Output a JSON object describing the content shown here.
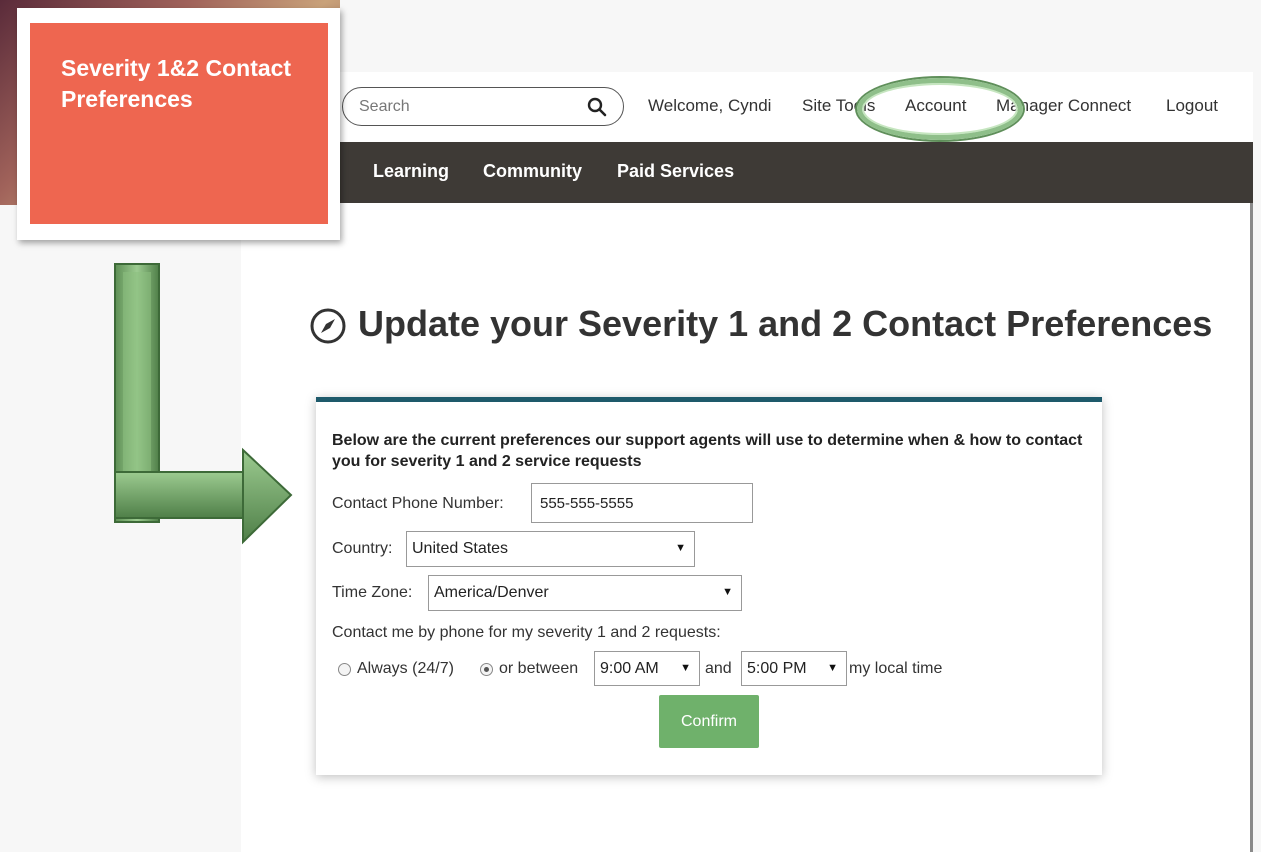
{
  "callout": {
    "title": "Severity 1&2 Contact Preferences",
    "color": "#ee6650"
  },
  "header": {
    "search_placeholder": "Search",
    "welcome": "Welcome, Cyndi",
    "links": [
      "Site Tools",
      "Account",
      "Manager Connect",
      "Logout"
    ]
  },
  "nav": {
    "items": [
      "Learning",
      "Community",
      "Paid Services"
    ]
  },
  "highlight": {
    "target": "Account",
    "color": "#8fbf8a"
  },
  "main": {
    "heading": "Update your Severity 1 and 2 Contact Preferences",
    "intro": "Below are the current preferences our support agents will use to determine when & how to contact you for severity 1 and 2 service requests",
    "phone": {
      "label": "Contact Phone Number:",
      "value": "555-555-5555"
    },
    "country": {
      "label": "Country:",
      "value": "United States"
    },
    "timezone": {
      "label": "Time Zone:",
      "value": "America/Denver"
    },
    "contact_label": "Contact me by phone for my severity 1 and 2 requests:",
    "option_always": "Always (24/7)",
    "option_between": "or between",
    "selected_option": "or between",
    "start_time": "9:00 AM",
    "and_label": "and",
    "end_time": "5:00 PM",
    "local_time_label": "my local time",
    "confirm_label": "Confirm",
    "accent": "#1e5a6b",
    "confirm_color": "#6fb16b"
  }
}
